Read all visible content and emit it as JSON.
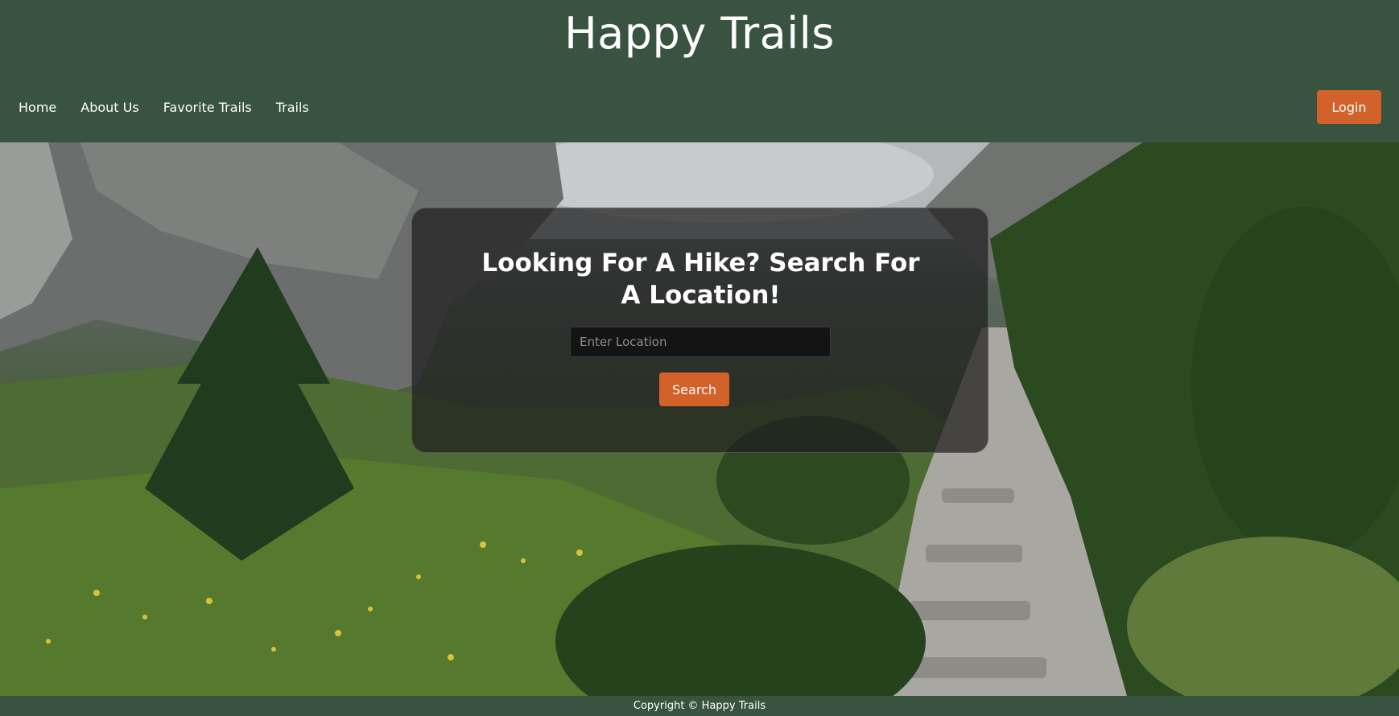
{
  "header": {
    "brand": "Happy Trails",
    "nav": [
      "Home",
      "About Us",
      "Favorite Trails",
      "Trails"
    ],
    "login_label": "Login"
  },
  "hero": {
    "title": "Looking For A Hike? Search For A Location!",
    "input_placeholder": "Enter Location",
    "search_label": "Search"
  },
  "footer": {
    "copyright": "Copyright © Happy Trails"
  },
  "colors": {
    "header_bg": "#38533f",
    "accent": "#d2622a"
  }
}
